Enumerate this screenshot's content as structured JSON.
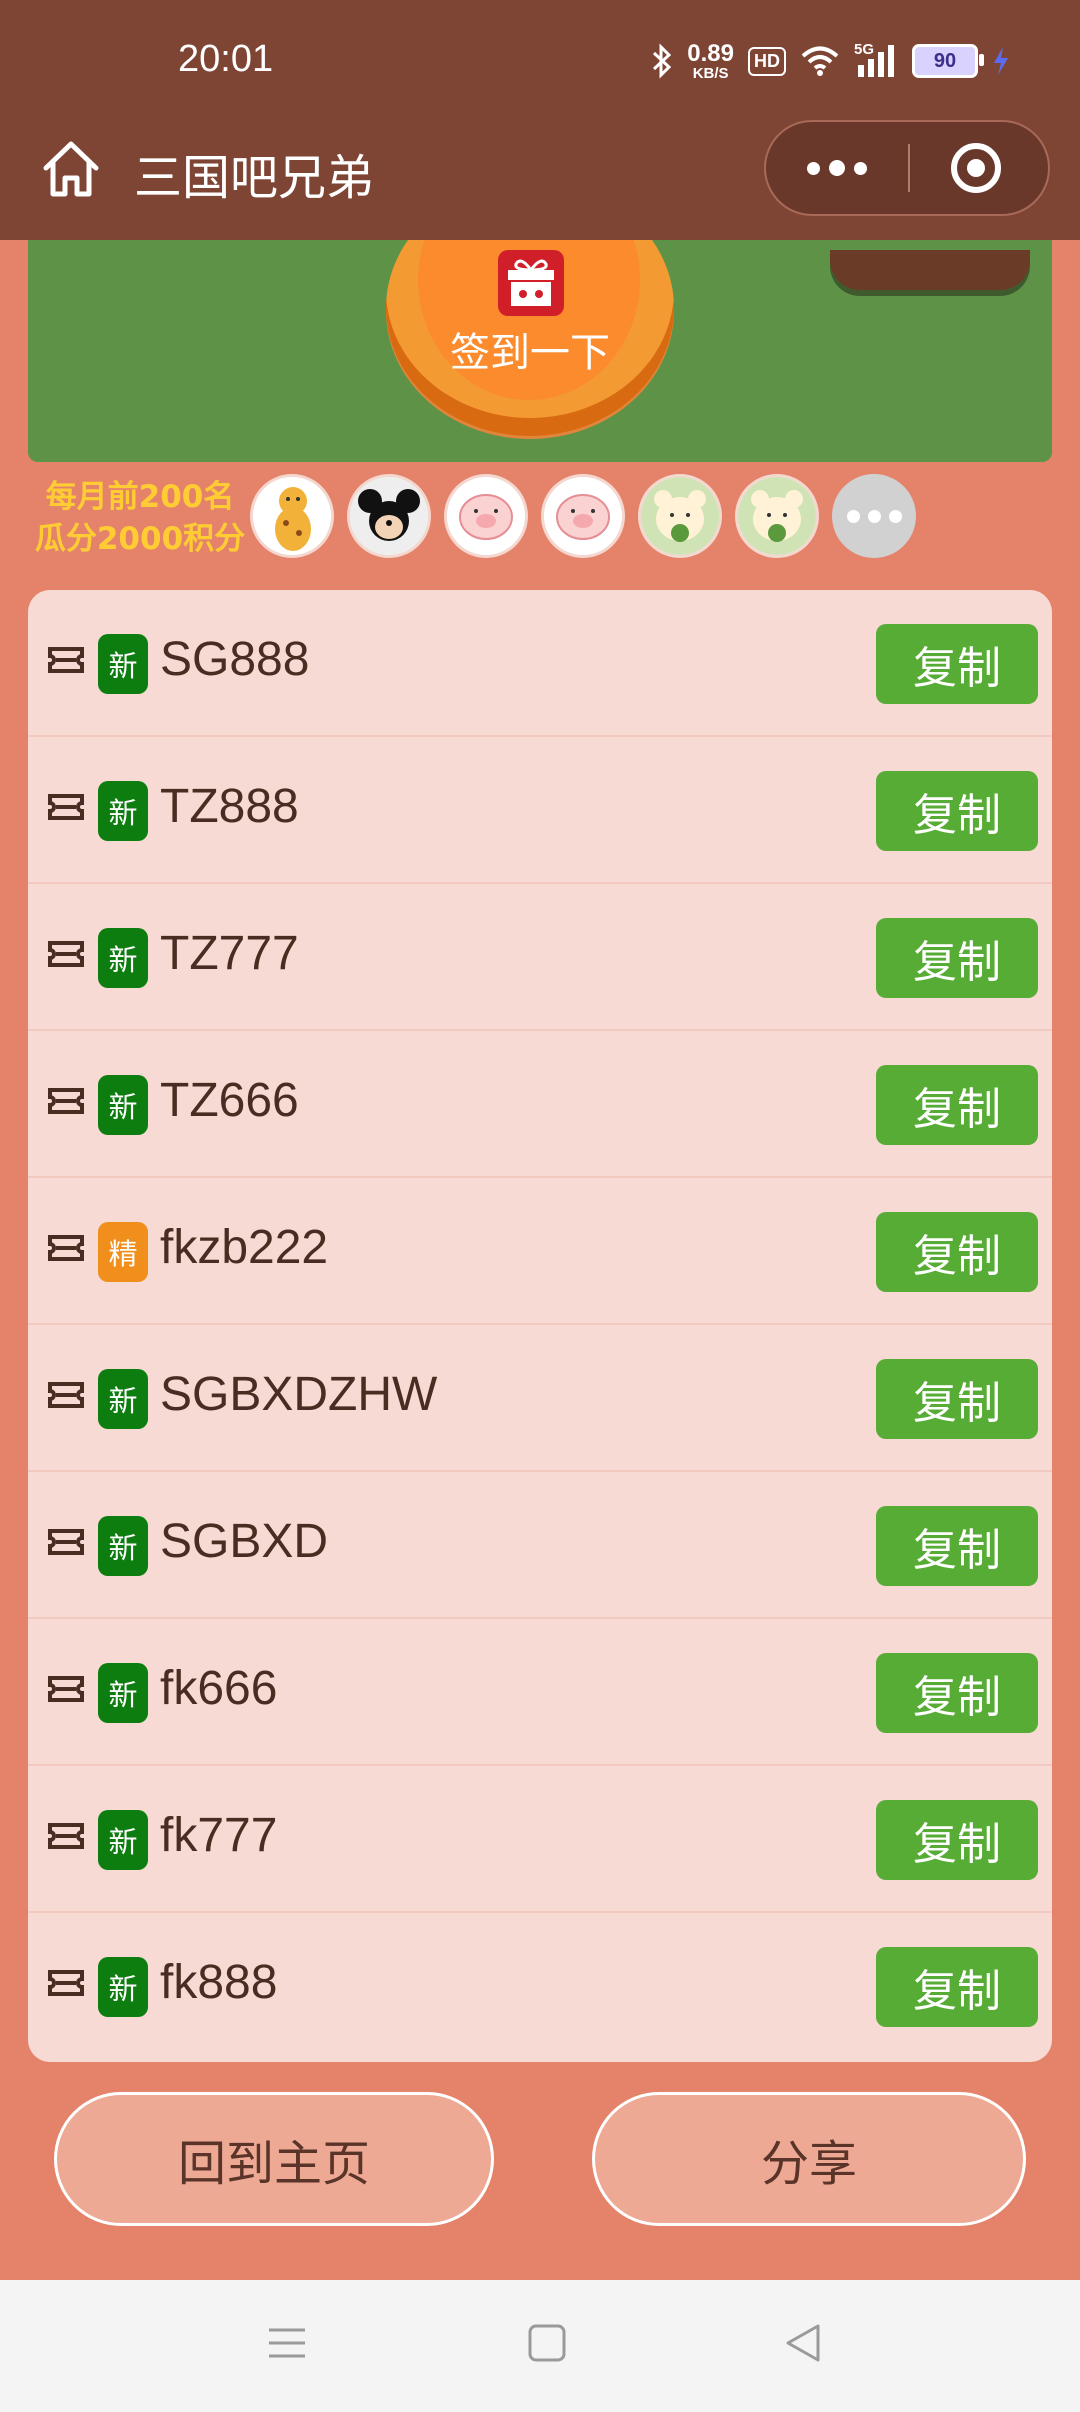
{
  "status_bar": {
    "time": "20:01",
    "speed_value": "0.89",
    "speed_unit": "KB/S",
    "hd": "HD",
    "network": "5G",
    "battery": "90"
  },
  "header": {
    "title": "三国吧兄弟"
  },
  "banner": {
    "signin_label": "签到一下"
  },
  "ranking": {
    "line1": "每月前200名",
    "line2": "瓜分2000积分",
    "avatars": [
      "giraffe",
      "mickey",
      "pig",
      "pig",
      "bear",
      "bear"
    ]
  },
  "codes": [
    {
      "tag": "新",
      "tag_color": "#0d7d10",
      "code": "SG888",
      "button": "复制"
    },
    {
      "tag": "新",
      "tag_color": "#0d7d10",
      "code": "TZ888",
      "button": "复制"
    },
    {
      "tag": "新",
      "tag_color": "#0d7d10",
      "code": "TZ777",
      "button": "复制"
    },
    {
      "tag": "新",
      "tag_color": "#0d7d10",
      "code": "TZ666",
      "button": "复制"
    },
    {
      "tag": "精",
      "tag_color": "#f08f1c",
      "code": "fkzb222",
      "button": "复制"
    },
    {
      "tag": "新",
      "tag_color": "#0d7d10",
      "code": "SGBXDZHW",
      "button": "复制"
    },
    {
      "tag": "新",
      "tag_color": "#0d7d10",
      "code": "SGBXD",
      "button": "复制"
    },
    {
      "tag": "新",
      "tag_color": "#0d7d10",
      "code": "fk666",
      "button": "复制"
    },
    {
      "tag": "新",
      "tag_color": "#0d7d10",
      "code": "fk777",
      "button": "复制"
    },
    {
      "tag": "新",
      "tag_color": "#0d7d10",
      "code": "fk888",
      "button": "复制"
    }
  ],
  "footer": {
    "home_label": "回到主页",
    "share_label": "分享"
  },
  "colors": {
    "background": "#e5836a",
    "header": "#7e4535",
    "copy_button": "#57ac35",
    "list_bg": "#f6dad3"
  }
}
